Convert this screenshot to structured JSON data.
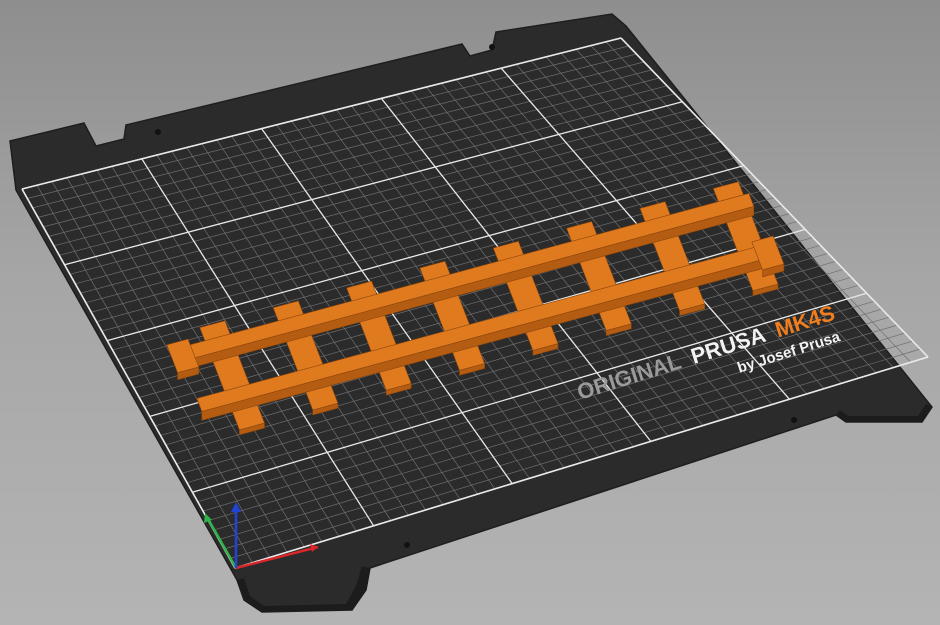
{
  "bed": {
    "logo_original": "ORIGINAL",
    "logo_prusa": "PRUSA",
    "logo_model": "MK4S",
    "logo_byline": "by Josef Prusa"
  },
  "colors": {
    "background": "#a0a0a0",
    "bed_plate": "#2b2b2b",
    "grid_fine": "#6e6e6e",
    "grid_major": "#e8e8e8",
    "model": "#e07a1f",
    "axis_x": "#d9262b",
    "axis_y": "#2fb24a",
    "axis_z": "#2144d6",
    "logo_grey": "#9a9a9a",
    "logo_white": "#f2f2f2",
    "logo_orange": "#f07d1e"
  },
  "model": {
    "name": "train-track-section",
    "sleepers": 8
  },
  "icons": {
    "axes": "xyz-axes-gizmo"
  }
}
